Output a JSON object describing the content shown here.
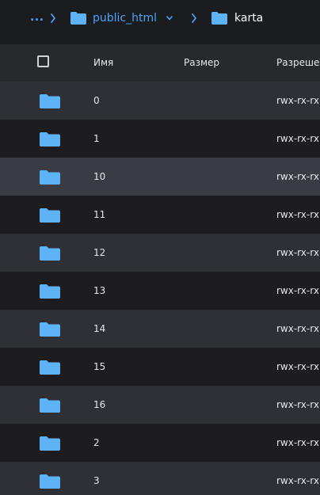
{
  "breadcrumb": {
    "ellipsis": "...",
    "items": [
      {
        "label": "public_html",
        "has_dropdown": true
      },
      {
        "label": "karta",
        "has_dropdown": false
      }
    ]
  },
  "table": {
    "columns": [
      {
        "label": "Имя"
      },
      {
        "label": "Размер"
      },
      {
        "label": "Разрешения"
      }
    ],
    "rows": [
      {
        "name": "0",
        "size": "",
        "permissions": "rwx-rx-rx"
      },
      {
        "name": "1",
        "size": "",
        "permissions": "rwx-rx-rx"
      },
      {
        "name": "10",
        "size": "",
        "permissions": "rwx-rx-rx"
      },
      {
        "name": "11",
        "size": "",
        "permissions": "rwx-rx-rx"
      },
      {
        "name": "12",
        "size": "",
        "permissions": "rwx-rx-rx"
      },
      {
        "name": "13",
        "size": "",
        "permissions": "rwx-rx-rx"
      },
      {
        "name": "14",
        "size": "",
        "permissions": "rwx-rx-rx"
      },
      {
        "name": "15",
        "size": "",
        "permissions": "rwx-rx-rx"
      },
      {
        "name": "16",
        "size": "",
        "permissions": "rwx-rx-rx"
      },
      {
        "name": "2",
        "size": "",
        "permissions": "rwx-rx-rx"
      },
      {
        "name": "3",
        "size": "",
        "permissions": "rwx-rx-rx"
      }
    ],
    "hovered_row_index": 2
  },
  "icons": {
    "folder": "folder-icon",
    "separator": "chevron-right-icon",
    "dropdown": "chevron-down-icon",
    "select_all": "checkbox-icon"
  },
  "colors": {
    "accent": "#4da3f5",
    "folder": "#5eb3f6",
    "background": "#1b1c1f",
    "header_bg": "#27292d",
    "row_light": "#2e3036",
    "row_dark": "#1d1d1f",
    "row_hover": "#3a3c43"
  }
}
